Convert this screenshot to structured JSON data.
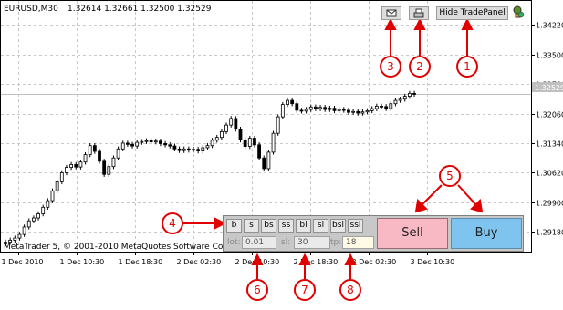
{
  "chart": {
    "symbol_tf": "EURUSD,M30",
    "ohlc": "1.32614 1.32661 1.32500 1.32529",
    "copyright": "MetaTrader 5, © 2001-2010 MetaQuotes Software Corp.",
    "current_price_label": "1.32529",
    "colors": {
      "background": "#ffffff",
      "candles": "#000000",
      "grid": "#c0c0c0",
      "bid_line": "#c0c0c0"
    }
  },
  "toolbar": {
    "mail_icon": "envelope-icon",
    "print_icon": "printer-icon",
    "hide_label": "Hide TradePanel",
    "expert_icon": "expert-advisor-icon"
  },
  "chart_data": {
    "type": "candlestick",
    "title": "EURUSD,M30",
    "ylim": [
      1.287,
      1.348
    ],
    "yticks": [
      "1.34220",
      "1.33500",
      "1.32780",
      "1.32060",
      "1.31340",
      "1.30620",
      "1.29900",
      "1.29180"
    ],
    "xticks": [
      "1 Dec 2010",
      "1 Dec 10:30",
      "1 Dec 18:30",
      "2 Dec 02:30",
      "2 Dec 10:30",
      "2 Dec 18:30",
      "3 Dec 02:30",
      "3 Dec 10:30"
    ],
    "series": [
      {
        "values": [
          1.2893,
          1.2898,
          1.2903,
          1.2912,
          1.293,
          1.2945,
          1.2952,
          1.2962,
          1.2978,
          1.2994,
          1.3018,
          1.304,
          1.3062,
          1.3075,
          1.3082,
          1.3076,
          1.3088,
          1.3106,
          1.3128,
          1.3114,
          1.309,
          1.3058,
          1.3077,
          1.3098,
          1.312,
          1.3134,
          1.3131,
          1.3127,
          1.3136,
          1.3138,
          1.314,
          1.3137,
          1.3139,
          1.3133,
          1.313,
          1.3127,
          1.312,
          1.3116,
          1.312,
          1.3117,
          1.3119,
          1.3115,
          1.3123,
          1.3128,
          1.3141,
          1.3148,
          1.3162,
          1.3178,
          1.3194,
          1.3168,
          1.3142,
          1.3126,
          1.3146,
          1.313,
          1.3098,
          1.3072,
          1.3112,
          1.3158,
          1.3198,
          1.3228,
          1.3238,
          1.323,
          1.3214,
          1.3212,
          1.3216,
          1.3222,
          1.3218,
          1.3221,
          1.3216,
          1.3219,
          1.3213,
          1.3216,
          1.3214,
          1.3209,
          1.3211,
          1.3207,
          1.321,
          1.3213,
          1.3218,
          1.3224,
          1.3223,
          1.3218,
          1.323,
          1.3238,
          1.3241,
          1.3248,
          1.3255,
          1.3253
        ]
      }
    ]
  },
  "trade_panel": {
    "commands": [
      "b",
      "s",
      "bs",
      "ss",
      "bl",
      "sl",
      "bsl",
      "ssl"
    ],
    "lot_label": "lot:",
    "lot_value": "0.01",
    "sl_label": "sl:",
    "sl_value": "30",
    "tp_label": "tp:",
    "tp_value": "18",
    "sell_label": "Sell",
    "buy_label": "Buy"
  },
  "callouts": [
    "1",
    "2",
    "3",
    "4",
    "5",
    "6",
    "7",
    "8"
  ]
}
